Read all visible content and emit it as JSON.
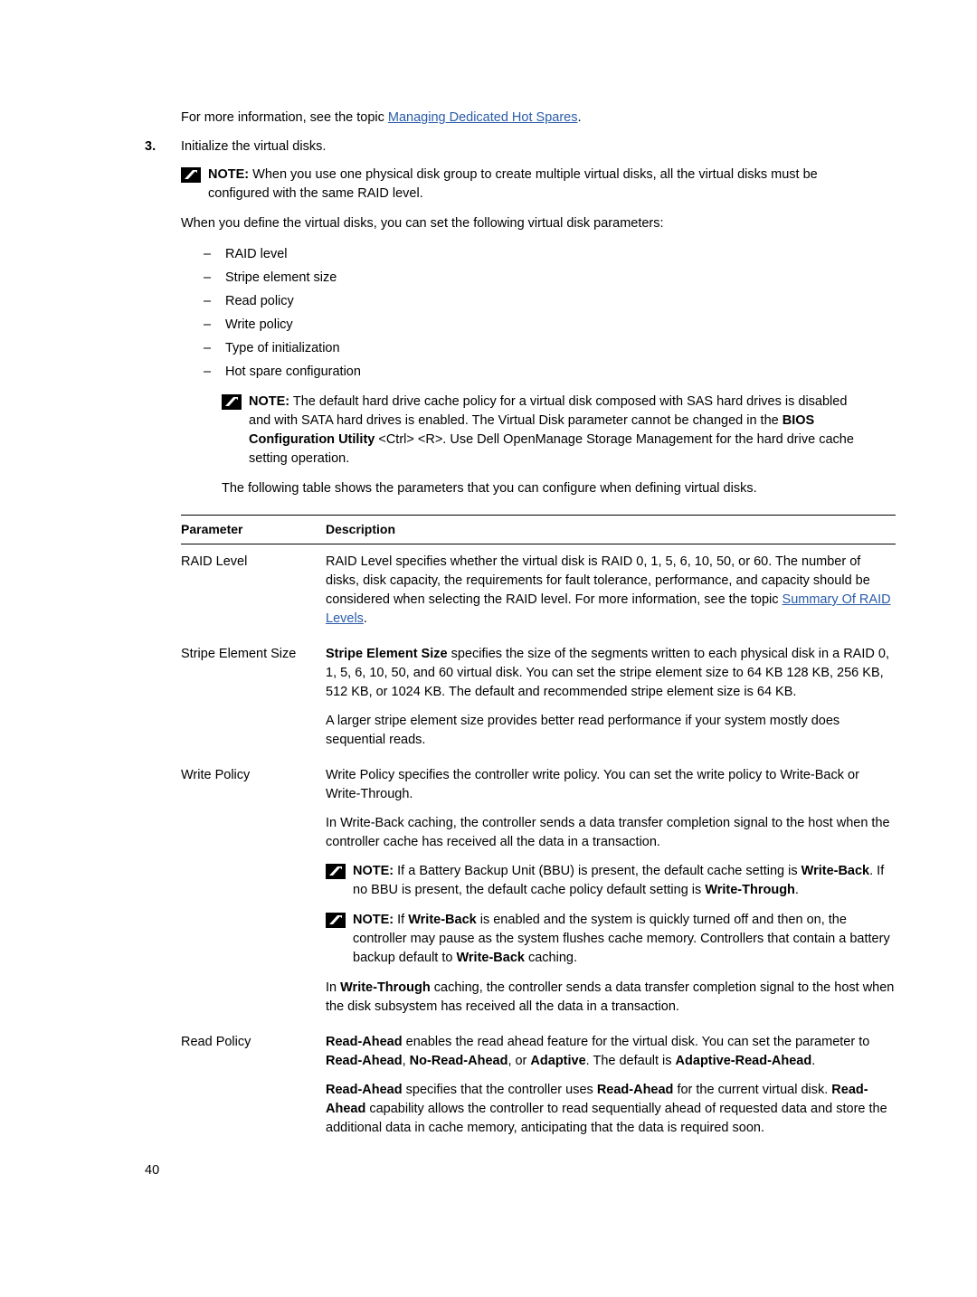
{
  "document": {
    "page_number": "40",
    "intro_line": {
      "prefix": "For more information, see the topic ",
      "link": "Managing Dedicated Hot Spares",
      "suffix": "."
    },
    "step": {
      "number": "3.",
      "text": "Initialize the virtual disks."
    },
    "note_1": {
      "label": "NOTE:",
      "text": " When you use one physical disk group to create multiple virtual disks, all the virtual disks must be configured with the same RAID level."
    },
    "params_intro": "When you define the virtual disks, you can set the following virtual disk parameters:",
    "bullets": [
      "RAID level",
      "Stripe element size",
      "Read policy",
      "Write policy",
      "Type of initialization",
      "Hot spare configuration"
    ],
    "note_2": {
      "label": "NOTE:",
      "part1": " The default hard drive cache policy for a virtual disk composed with SAS hard drives is disabled and with SATA hard drives is enabled. The Virtual Disk parameter cannot be changed in the ",
      "bold1": "BIOS Configuration Utility",
      "part2": " <Ctrl> <R>. Use Dell OpenManage Storage Management for the hard drive cache setting operation."
    },
    "table_intro": "The following table shows the parameters that you can configure when defining virtual disks.",
    "table": {
      "headers": [
        "Parameter",
        "Description"
      ],
      "rows": [
        {
          "parameter": "RAID Level",
          "paragraphs": [
            {
              "text": "RAID Level specifies whether the virtual disk is RAID 0, 1, 5, 6, 10, 50, or 60. The number of disks, disk capacity, the requirements for fault tolerance, performance, and capacity should be considered when selecting the RAID level. For more information, see the topic ",
              "link": "Summary Of RAID Levels",
              "after": "."
            }
          ]
        },
        {
          "parameter": "Stripe Element Size",
          "paragraphs": [
            {
              "bold_lead": "Stripe Element Size",
              "text": " specifies the size of the segments written to each physical disk in a RAID 0, 1, 5, 6, 10, 50, and 60 virtual disk. You can set the stripe element size to 64 KB 128 KB, 256 KB, 512 KB, or 1024 KB. The default and recommended stripe element size is 64 KB."
            },
            {
              "text": "A larger stripe element size provides better read performance if your system mostly does sequential reads."
            }
          ]
        },
        {
          "parameter": "Write Policy",
          "paragraphs": [
            {
              "text": "Write Policy specifies the controller write policy. You can set the write policy to Write-Back or Write-Through."
            },
            {
              "text": "In Write-Back caching, the controller sends a data transfer completion signal to the host when the controller cache has received all the data in a transaction."
            }
          ],
          "notes": [
            {
              "label": "NOTE:",
              "segments": [
                {
                  "t": " If a Battery Backup Unit (BBU) is present, the default cache setting is "
                },
                {
                  "t": "Write-Back",
                  "b": true
                },
                {
                  "t": ". If no BBU is present, the default cache policy default setting is "
                },
                {
                  "t": "Write-Through",
                  "b": true
                },
                {
                  "t": "."
                }
              ]
            },
            {
              "label": "NOTE:",
              "segments": [
                {
                  "t": " If "
                },
                {
                  "t": "Write-Back",
                  "b": true
                },
                {
                  "t": " is enabled and the system is quickly turned off and then on, the controller may pause as the system flushes cache memory. Controllers that contain a battery backup default to "
                },
                {
                  "t": "Write-Back",
                  "b": true
                },
                {
                  "t": " caching."
                }
              ]
            }
          ],
          "trailing_paragraphs": [
            {
              "segments": [
                {
                  "t": "In "
                },
                {
                  "t": "Write-Through",
                  "b": true
                },
                {
                  "t": " caching, the controller sends a data transfer completion signal to the host when the disk subsystem has received all the data in a transaction."
                }
              ]
            }
          ]
        },
        {
          "parameter": "Read Policy",
          "paragraphs": [
            {
              "segments": [
                {
                  "t": "Read-Ahead",
                  "b": true
                },
                {
                  "t": " enables the read ahead feature for the virtual disk. You can set the parameter to "
                },
                {
                  "t": "Read-Ahead",
                  "b": true
                },
                {
                  "t": ", "
                },
                {
                  "t": "No-Read-Ahead",
                  "b": true
                },
                {
                  "t": ", or "
                },
                {
                  "t": "Adaptive",
                  "b": true
                },
                {
                  "t": ". The default is "
                },
                {
                  "t": "Adaptive-Read-Ahead",
                  "b": true
                },
                {
                  "t": "."
                }
              ]
            },
            {
              "segments": [
                {
                  "t": "Read-Ahead",
                  "b": true
                },
                {
                  "t": " specifies that the controller uses "
                },
                {
                  "t": "Read-Ahead",
                  "b": true
                },
                {
                  "t": " for the current virtual disk. "
                },
                {
                  "t": "Read-Ahead",
                  "b": true
                },
                {
                  "t": " capability allows the controller to read sequentially ahead of requested data and store the additional data in cache memory, anticipating that the data is required soon."
                }
              ]
            }
          ]
        }
      ]
    }
  }
}
